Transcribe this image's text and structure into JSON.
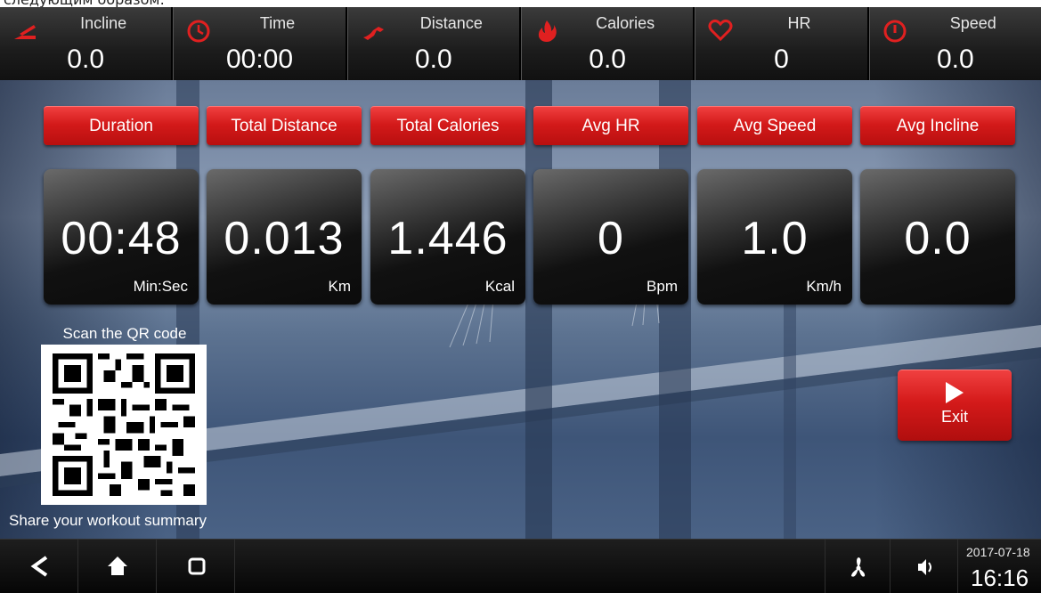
{
  "caption_fragment": "следующим образом:",
  "stats": [
    {
      "label": "Incline",
      "value": "0.0",
      "icon": "incline-icon"
    },
    {
      "label": "Time",
      "value": "00:00",
      "icon": "clock-icon"
    },
    {
      "label": "Distance",
      "value": "0.0",
      "icon": "runner-icon"
    },
    {
      "label": "Calories",
      "value": "0.0",
      "icon": "flame-icon"
    },
    {
      "label": "HR",
      "value": "0",
      "icon": "heart-icon"
    },
    {
      "label": "Speed",
      "value": "0.0",
      "icon": "speedometer-icon"
    }
  ],
  "summary": [
    {
      "title": "Duration",
      "value": "00:48",
      "unit": "Min:Sec"
    },
    {
      "title": "Total Distance",
      "value": "0.013",
      "unit": "Km"
    },
    {
      "title": "Total Calories",
      "value": "1.446",
      "unit": "Kcal"
    },
    {
      "title": "Avg HR",
      "value": "0",
      "unit": "Bpm"
    },
    {
      "title": "Avg Speed",
      "value": "1.0",
      "unit": "Km/h"
    },
    {
      "title": "Avg Incline",
      "value": "0.0",
      "unit": ""
    }
  ],
  "qr": {
    "caption": "Scan the QR code",
    "share": "Share your workout summary"
  },
  "exit": {
    "label": "Exit",
    "icon": "play-icon"
  },
  "navbar": {
    "back_icon": "back-icon",
    "home_icon": "home-icon",
    "recents_icon": "recents-icon",
    "fan_icon": "fan-icon",
    "volume_icon": "volume-icon",
    "date": "2017-07-18",
    "time": "16:16"
  },
  "colors": {
    "accent_red": "#d41a1a",
    "icon_red": "#e02020",
    "bar_dark": "#1c1c1c"
  }
}
